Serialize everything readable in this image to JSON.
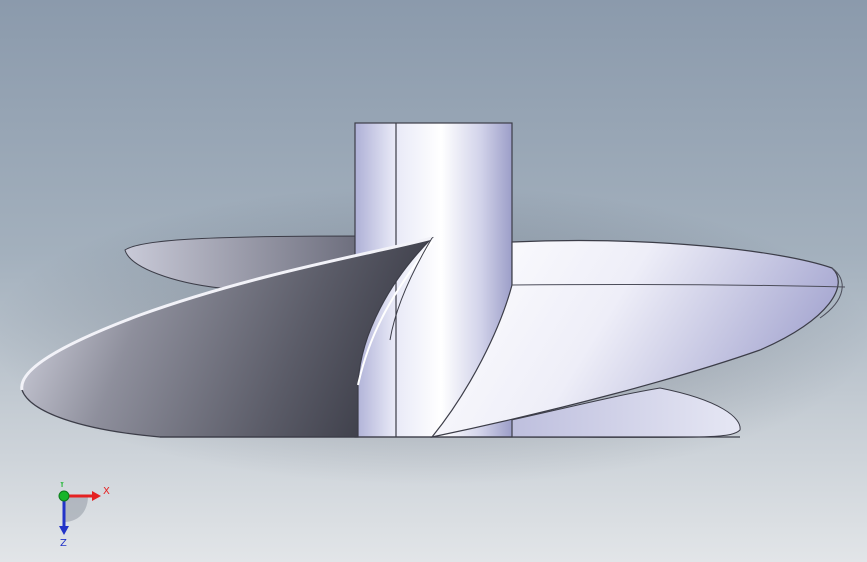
{
  "viewport": {
    "background_top": "#8b9aac",
    "background_bottom": "#e2e5e8"
  },
  "model": {
    "type": "propeller",
    "hub_color": "#c9cbe6",
    "blade_light": "#e9eaf6",
    "blade_dark": "#4a4b56"
  },
  "triad": {
    "x_label": "X",
    "y_label": "Y",
    "z_label": "Z",
    "x_color": "#e52222",
    "y_color": "#17b52a",
    "z_color": "#2233c8"
  }
}
